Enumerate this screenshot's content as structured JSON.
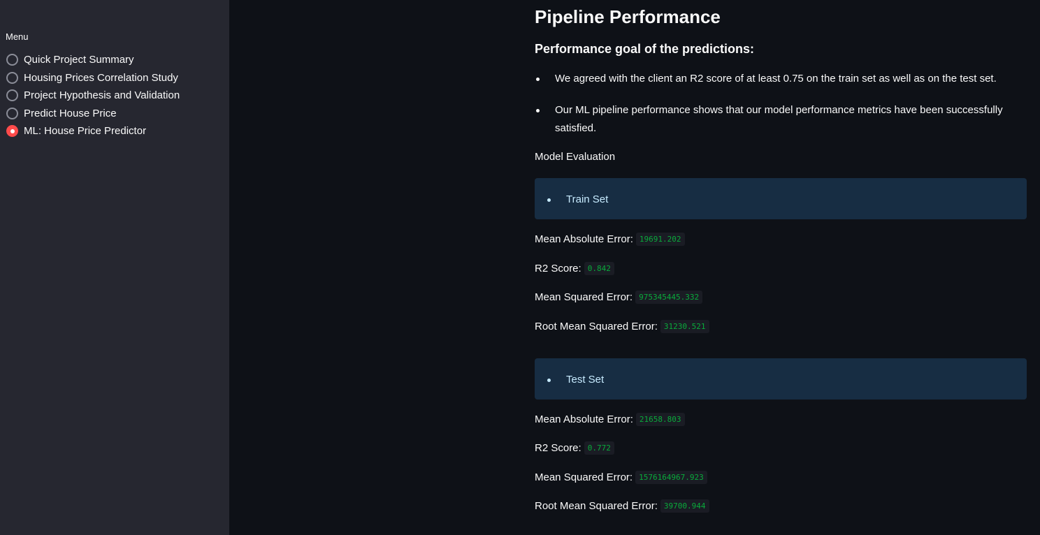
{
  "sidebar": {
    "menu_title": "Menu",
    "items": [
      {
        "label": "Quick Project Summary",
        "selected": false
      },
      {
        "label": "Housing Prices Correlation Study",
        "selected": false
      },
      {
        "label": "Project Hypothesis and Validation",
        "selected": false
      },
      {
        "label": "Predict House Price",
        "selected": false
      },
      {
        "label": "ML: House Price Predictor",
        "selected": true
      }
    ]
  },
  "main": {
    "title": "Pipeline Performance",
    "subheading": "Performance goal of the predictions:",
    "bullets": [
      "We agreed with the client an R2 score of at least 0.75 on the train set as well as on the test set.",
      "Our ML pipeline performance shows that our model performance metrics have been successfully satisfied."
    ],
    "evaluation_label": "Model Evaluation",
    "train": {
      "heading": "Train Set",
      "metrics": [
        {
          "label": "Mean Absolute Error:",
          "value": "19691.202"
        },
        {
          "label": "R2 Score:",
          "value": "0.842"
        },
        {
          "label": "Mean Squared Error:",
          "value": "975345445.332"
        },
        {
          "label": "Root Mean Squared Error:",
          "value": "31230.521"
        }
      ]
    },
    "test": {
      "heading": "Test Set",
      "metrics": [
        {
          "label": "Mean Absolute Error:",
          "value": "21658.803"
        },
        {
          "label": "R2 Score:",
          "value": "0.772"
        },
        {
          "label": "Mean Squared Error:",
          "value": "1576164967.923"
        },
        {
          "label": "Root Mean Squared Error:",
          "value": "39700.944"
        }
      ]
    }
  },
  "colors": {
    "sidebar_bg": "#262730",
    "main_bg": "#0e1117",
    "accent": "#ff4b4b",
    "info_bg": "#172d43",
    "info_text": "#c7ebff",
    "code_text": "#09ab3b"
  }
}
